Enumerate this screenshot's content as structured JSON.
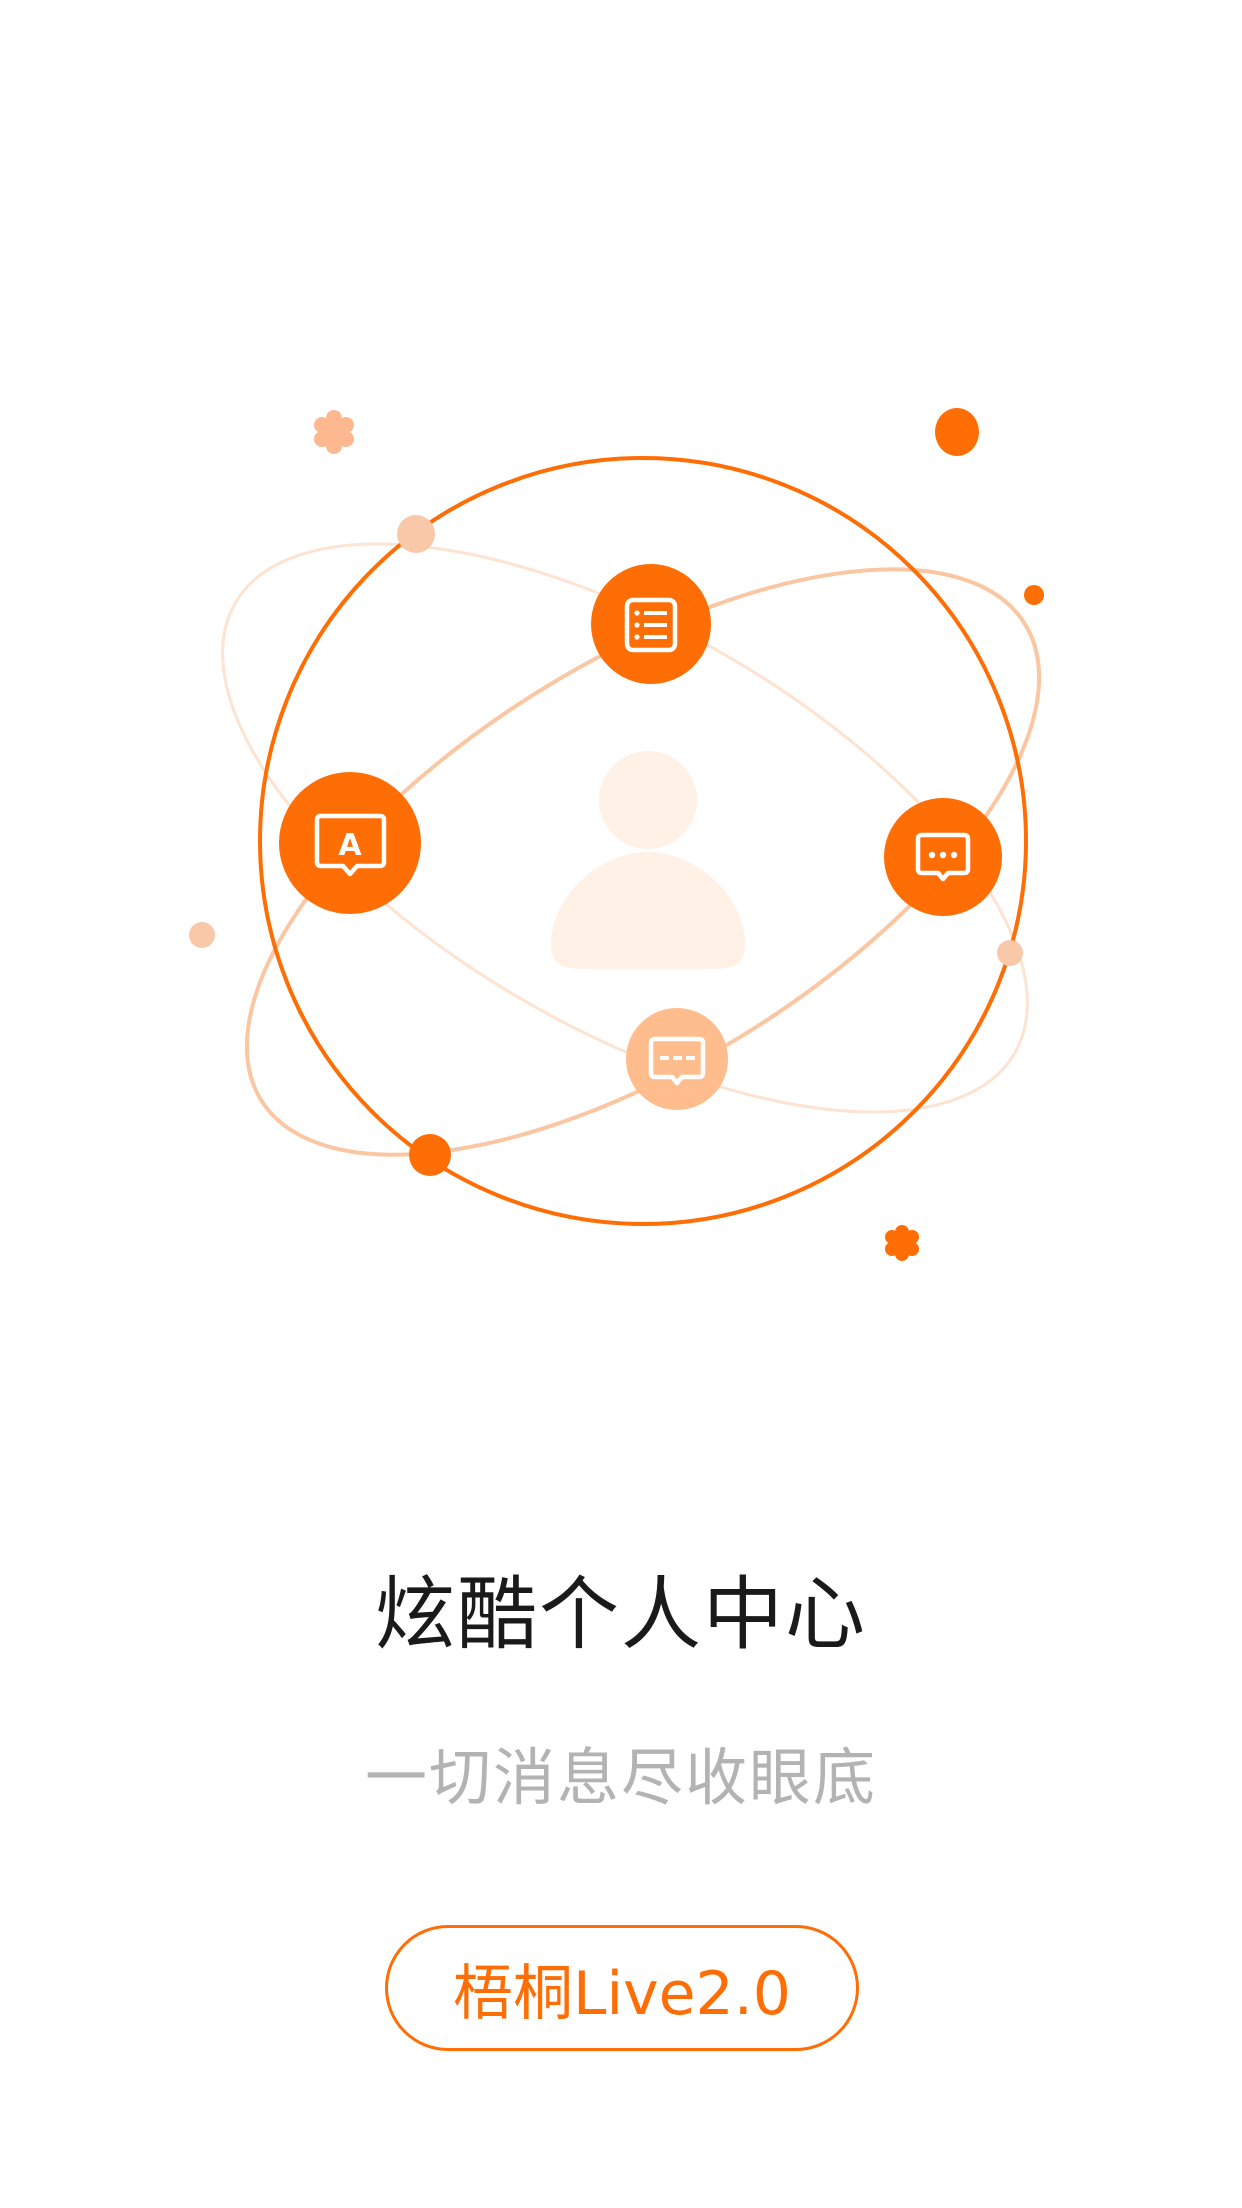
{
  "colors": {
    "accent": "#ff6d05",
    "accent_light": "#ffbd8d",
    "accent_pale": "#f9c8a8",
    "avatar_fill": "#fff1e6",
    "title": "#1a1a1a",
    "subtitle": "#b3b3b3"
  },
  "illustration": {
    "center_icon": "user-silhouette-icon",
    "orbit_icons": [
      "list-icon",
      "font-message-icon",
      "chat-dots-icon",
      "chat-dashes-icon"
    ],
    "icon_letter": "A"
  },
  "title": "炫酷个人中心",
  "subtitle": "一切消息尽收眼底",
  "action_button": {
    "label": "梧桐Live2.0"
  }
}
